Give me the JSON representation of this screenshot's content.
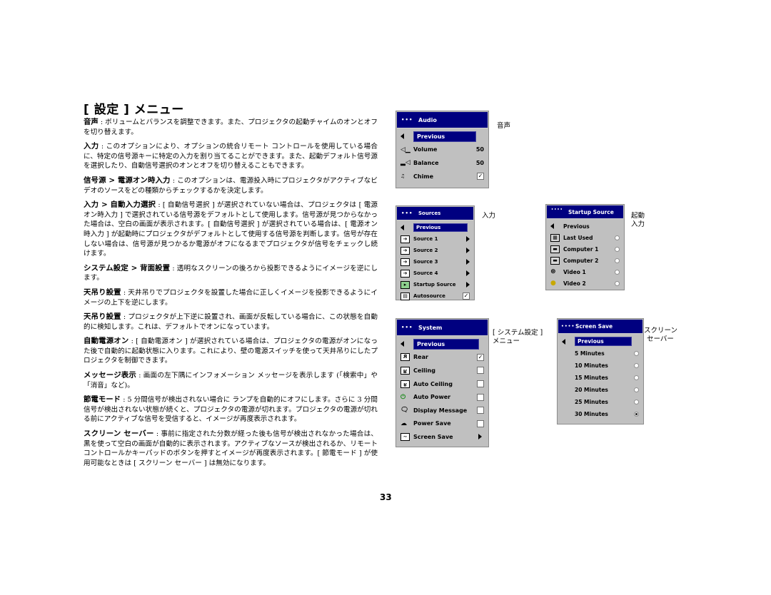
{
  "page": {
    "title": "[ 設定 ] メニュー",
    "page_number": "33"
  },
  "paragraphs": [
    {
      "term": "音声",
      "text": " : ボリュームとバランスを調整できます。また、プロジェクタの起動チャイムのオンとオフを切り替えます。"
    },
    {
      "term": "入力",
      "text": " : このオプションにより、オプションの統合リモート コントロールを使用している場合に、特定の信号源キーに特定の入力を割り当てることができます。また、起動デフォルト信号源を選択したり、自動信号選択のオンとオフを切り替えることもできます。"
    },
    {
      "term": "信号源 > 電源オン時入力",
      "text": " : このオプションは、電源投入時にプロジェクタがアクティブなビデオのソースをどの種類からチェックするかを決定します。"
    },
    {
      "term": "入力 > 自動入力選択",
      "text": " : [ 自動信号選択 ] が選択されていない場合は、プロジェクタは [ 電源オン時入力 ] で選択されている信号源をデフォルトとして使用します。信号源が見つからなかった場合は、空白の画面が表示されます。[ 自動信号選択 ] が選択されている場合は、[ 電源オン時入力 ] が起動時にプロジェクタがデフォルトとして使用する信号源を判断します。信号が存在しない場合は、信号源が見つかるか電源がオフになるまでプロジェクタが信号をチェックし続けます。"
    },
    {
      "term": "システム設定 > 背面設置",
      "text": " : 透明なスクリーンの後ろから投影できるようにイメージを逆にします。"
    },
    {
      "term": "天吊り設置",
      "text": " : 天井吊りでプロジェクタを設置した場合に正しくイメージを投影できるようにイメージの上下を逆にします。"
    },
    {
      "term": "天吊り設置",
      "text": " : プロジェクタが上下逆に設置され、画面が反転している場合に、この状態を自動的に検知します。これは、デフォルトでオンになっています。"
    },
    {
      "term": "自動電源オン",
      "text": " : [ 自動電源オン ] が選択されている場合は、プロジェクタの電源がオンになった後で自動的に起動状態に入ります。これにより、壁の電源スイッチを使って天井吊りにしたプロジェクタを制御できます。"
    },
    {
      "term": "メッセージ表示",
      "text": " : 画面の左下隅にインフォメーション メッセージを表示します (「検索中」や「消音」など)。"
    },
    {
      "term": "節電モード",
      "text": " : 5 分間信号が検出されない場合に ランプを自動的にオフにします。さらに 3 分間信号が検出されない状態が続くと、プロジェクタの電源が切れます。プロジェクタの電源が切れる前にアクティブな信号を受信すると、イメージが再度表示されます。"
    },
    {
      "term": "スクリーン セーバー",
      "text": " : 事前に指定された分数が経った後も信号が検出されなかった場合は、黒を使って空白の画面が自動的に表示されます。アクティブなソースが検出されるか、リモート コントロールかキーパッドのボタンを押すとイメージが再度表示されます。[ 節電モード ] が使用可能なときは [ スクリーン セーバー ] は無効になります。"
    }
  ],
  "menus": {
    "audio": {
      "header_dots": "•••",
      "title": "Audio",
      "caption": "音声",
      "previous": "Previous",
      "items": [
        {
          "label": "Volume",
          "value": "50",
          "icon": "volume-icon"
        },
        {
          "label": "Balance",
          "value": "50",
          "icon": "balance-icon"
        },
        {
          "label": "Chime",
          "value": "✓",
          "icon": "chime-icon",
          "checked": true
        }
      ]
    },
    "sources": {
      "header_dots": "•••",
      "title": "Sources",
      "caption": "入力",
      "previous": "Previous",
      "items": [
        {
          "label": "Source 1"
        },
        {
          "label": "Source 2"
        },
        {
          "label": "Source 3"
        },
        {
          "label": "Source 4"
        },
        {
          "label": "Startup Source"
        },
        {
          "label": "Autosource",
          "checked": true,
          "check_mark": "✓"
        }
      ]
    },
    "startup_source": {
      "header_dots": "••••",
      "title": "Startup Source",
      "caption_line1": "起動",
      "caption_line2": "入力",
      "previous": "Previous",
      "items": [
        {
          "label": "Last Used",
          "selected": false
        },
        {
          "label": "Computer 1",
          "selected": false
        },
        {
          "label": "Computer 2",
          "selected": false
        },
        {
          "label": "Video 1",
          "selected": false
        },
        {
          "label": "Video 2",
          "selected": false
        }
      ]
    },
    "system": {
      "header_dots": "•••",
      "title": "System",
      "caption_line1": "[ システム設定 ]",
      "caption_line2": "メニュー",
      "previous": "Previous",
      "items": [
        {
          "label": "Rear",
          "checked": true,
          "check_mark": "✓",
          "icon_glyph": "R"
        },
        {
          "label": "Ceiling",
          "checked": false,
          "check_mark": "",
          "icon_glyph": "R"
        },
        {
          "label": "Auto Ceiling",
          "checked": false,
          "check_mark": "",
          "icon_glyph": "R"
        },
        {
          "label": "Auto Power",
          "checked": false,
          "check_mark": ""
        },
        {
          "label": "Display Message",
          "checked": false,
          "check_mark": ""
        },
        {
          "label": "Power Save",
          "checked": false,
          "check_mark": ""
        },
        {
          "label": "Screen Save",
          "submenu": true
        }
      ]
    },
    "screen_save": {
      "header_dots": "••••",
      "title": "Screen Save",
      "caption_line1": "スクリーン",
      "caption_line2": "セーバー",
      "previous": "Previous",
      "items": [
        {
          "label": "5 Minutes",
          "selected": false
        },
        {
          "label": "10 Minutes",
          "selected": false
        },
        {
          "label": "15 Minutes",
          "selected": false
        },
        {
          "label": "20 Minutes",
          "selected": false
        },
        {
          "label": "25 Minutes",
          "selected": false
        },
        {
          "label": "30 Minutes",
          "selected": true
        }
      ]
    }
  },
  "colors": {
    "menu_header": "#000080",
    "menu_body": "#c0c0c0"
  }
}
